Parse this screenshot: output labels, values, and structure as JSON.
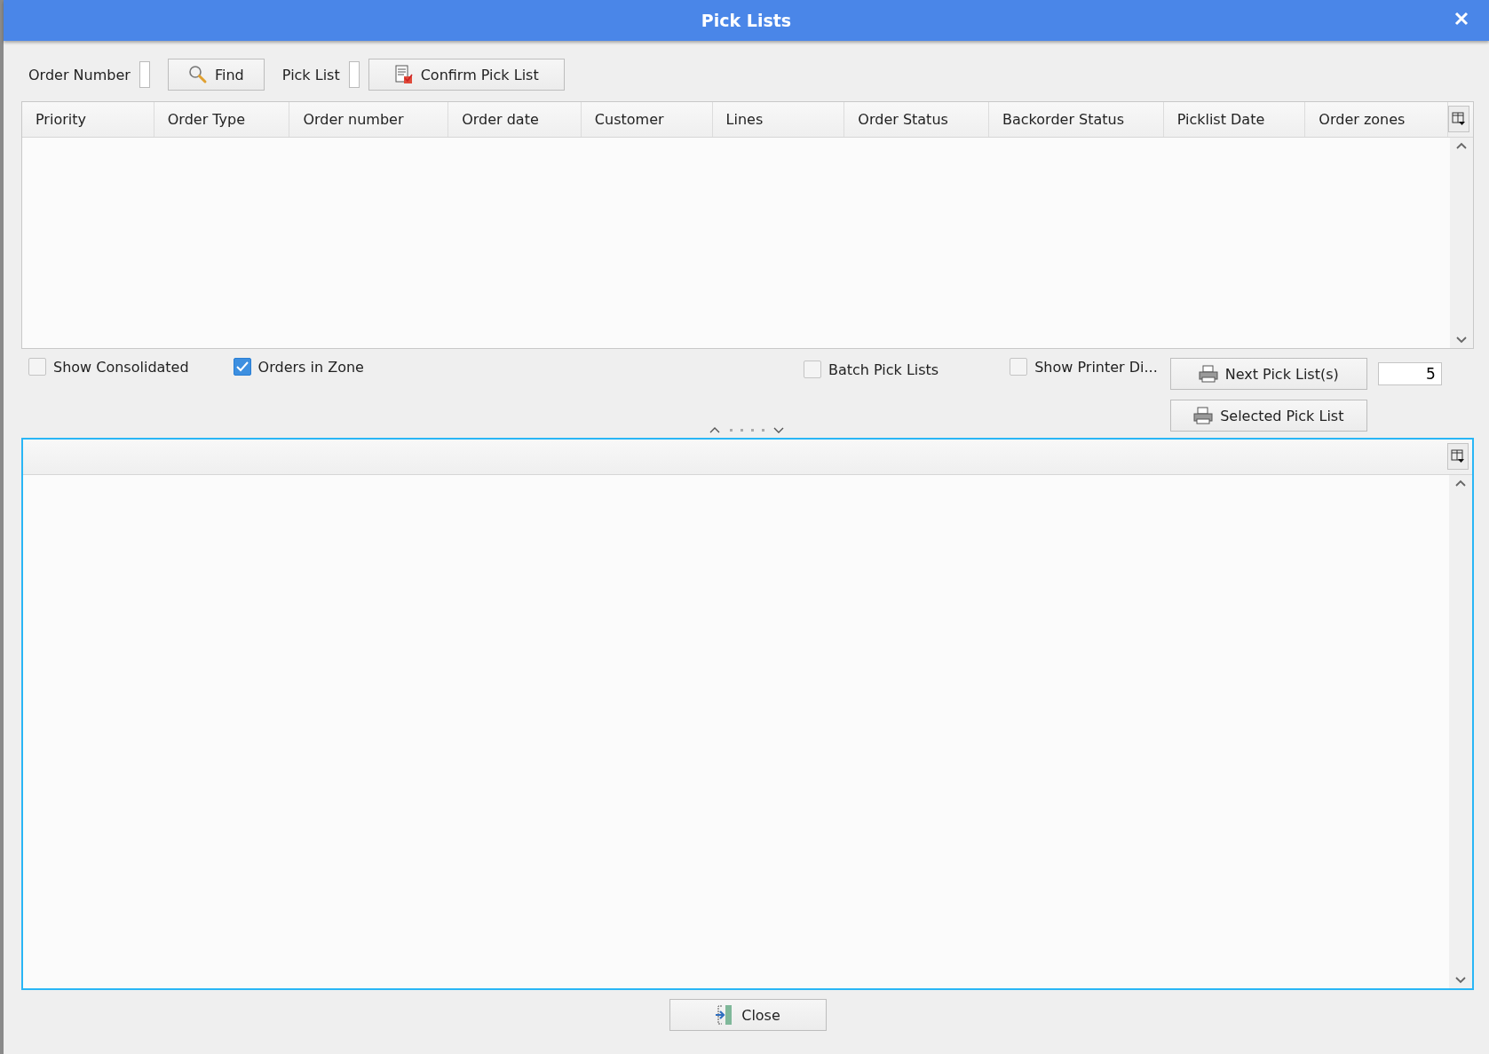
{
  "window": {
    "title": "Pick Lists"
  },
  "toolbar": {
    "order_number_label": "Order Number",
    "find_button": "Find",
    "pick_list_label": "Pick List",
    "confirm_button": "Confirm Pick List"
  },
  "orders_table": {
    "columns": [
      "Priority",
      "Order Type",
      "Order number",
      "Order date",
      "Customer",
      "Lines",
      "Order Status",
      "Backorder Status",
      "Picklist Date",
      "Order zones"
    ]
  },
  "options": [
    {
      "label": "Show Consolidated",
      "checked": false
    },
    {
      "label": "Orders in Zone",
      "checked": true
    },
    {
      "label": "Batch Pick Lists",
      "checked": false
    },
    {
      "label": "Show Printer Di...",
      "checked": false
    }
  ],
  "print": {
    "next_button": "Next Pick List(s)",
    "count": "5",
    "selected_button": "Selected Pick List"
  },
  "footer": {
    "close_button": "Close"
  }
}
